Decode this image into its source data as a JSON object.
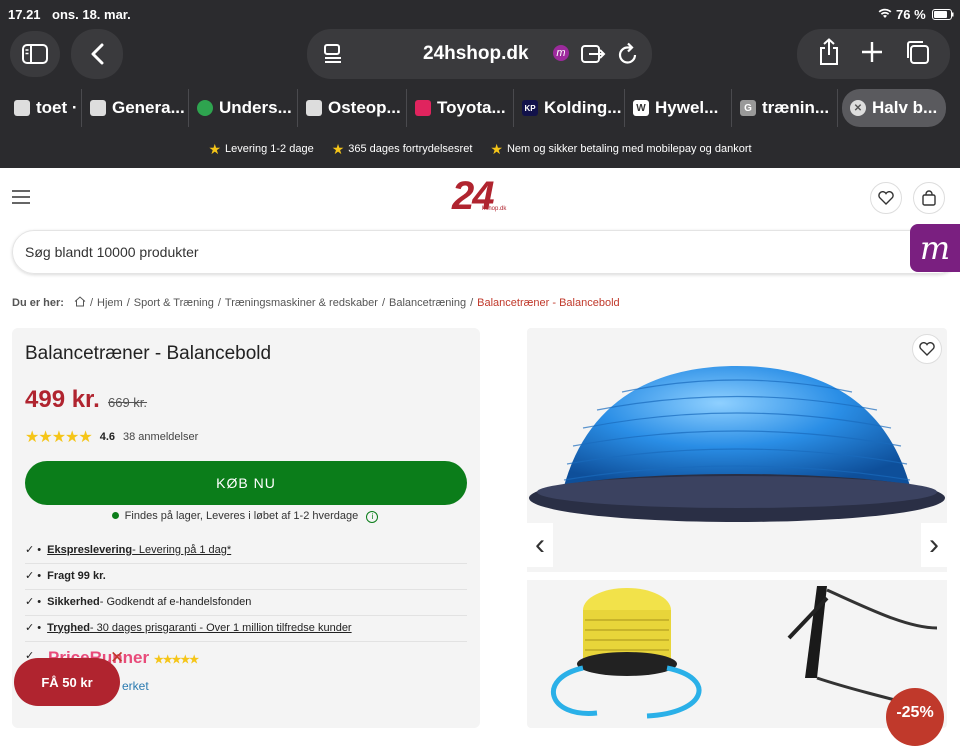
{
  "status": {
    "time": "17.21",
    "date": "ons. 18. mar.",
    "battery": "76 %"
  },
  "browser": {
    "url": "24hshop.dk"
  },
  "tabs": [
    {
      "label": "toet ·",
      "icon": "tab-favicon"
    },
    {
      "label": "Genera...",
      "icon": "tab-favicon"
    },
    {
      "label": "Unders...",
      "icon": "tab-favicon"
    },
    {
      "label": "Osteop...",
      "icon": "tab-favicon"
    },
    {
      "label": "Toyota...",
      "icon": "tab-favicon"
    },
    {
      "label": "Kolding...",
      "icon": "tab-favicon"
    },
    {
      "label": "Hywel...",
      "icon": "tab-favicon"
    },
    {
      "label": "trænin...",
      "icon": "tab-favicon"
    },
    {
      "label": "Halv b...",
      "icon": "close-icon"
    }
  ],
  "perks": [
    "Levering 1-2 dage",
    "365 dages fortrydelsesret",
    "Nem og sikker betaling med mobilepay og dankort"
  ],
  "logo": {
    "main": "24",
    "sub": "hshop.dk"
  },
  "search": {
    "placeholder": "Søg blandt 10000 produkter"
  },
  "badge": {
    "letter": "m"
  },
  "breadcrumb": {
    "label": "Du er her:",
    "items": [
      "Hjem",
      "Sport & Træning",
      "Træningsmaskiner & redskaber",
      "Balancetræning"
    ],
    "current": "Balancetræner - Balancebold"
  },
  "product": {
    "title": "Balancetræner - Balancebold",
    "price": "499 kr.",
    "old_price": "669 kr.",
    "rating": "4.6",
    "reviews": "38 anmeldelser",
    "buy": "KØB NU",
    "stock": "Findes på lager, Leveres i løbet af 1-2 hverdage"
  },
  "features": [
    {
      "title": "Ekspreslevering",
      "text": " - Levering på 1 dag*"
    },
    {
      "title": "Fragt 99 kr.",
      "text": ""
    },
    {
      "title": "Sikkerhed",
      "text": " - Godkendt af e-handelsfonden"
    },
    {
      "title": "Tryghed",
      "text": " - 30 dages prisgaranti - Over 1 million tilfredse kunder"
    }
  ],
  "pricerunner": {
    "logo": "PriceRunner",
    "link": "erket"
  },
  "fab": {
    "label": "FÅ 50 kr"
  },
  "sale": {
    "label": "-25%"
  },
  "colors": {
    "brand": "#b0242f",
    "buy": "#0b7d1a",
    "chrome": "#2b2b2e"
  }
}
